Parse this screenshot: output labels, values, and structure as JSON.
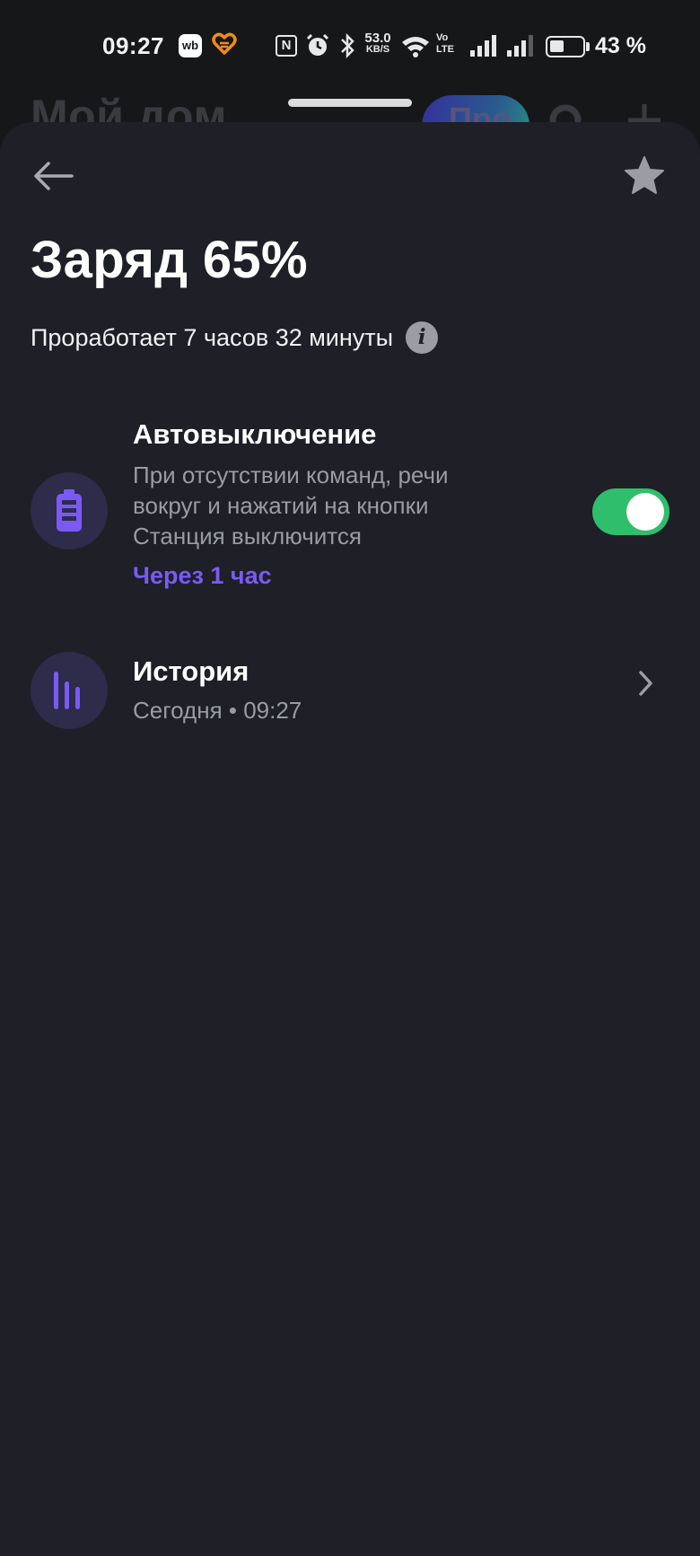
{
  "status_bar": {
    "time": "09:27",
    "wb_badge": "wb",
    "nfc_label": "N",
    "speed_value": "53.0",
    "speed_unit": "KB/S",
    "volte_top": "Vo",
    "volte_bottom": "LTE",
    "battery_percent_text": "43 %",
    "battery_level": 0.43,
    "icons": [
      "wb-app-icon",
      "heart-app-icon",
      "nfc-icon",
      "alarm-icon",
      "bluetooth-icon",
      "wifi-icon",
      "volte-icon",
      "signal-icon",
      "signal-icon",
      "battery-icon"
    ]
  },
  "background_screen": {
    "title": "Мой дом",
    "pill_text": "Про"
  },
  "sheet": {
    "back_icon": "arrow-left-icon",
    "favorite_icon": "star-icon",
    "charge_title": "Заряд 65%",
    "runtime_text": "Проработает 7 часов 32 минуты",
    "info_glyph": "i",
    "auto_off": {
      "title": "Автовыключение",
      "description": "При отсутствии команд, речи вокруг и нажатий на кнопки Станция выключится",
      "timer": "Через 1 час",
      "enabled": true,
      "icon": "battery-icon"
    },
    "history": {
      "title": "История",
      "subtitle": "Сегодня • 09:27",
      "icon": "bars-icon"
    }
  },
  "colors": {
    "sheet_bg": "#1e1f27",
    "accent": "#7a5af5",
    "toggle_on": "#2fbe6b",
    "icon_circle": "#2e2b4b",
    "secondary_text": "#9a9ca3"
  }
}
